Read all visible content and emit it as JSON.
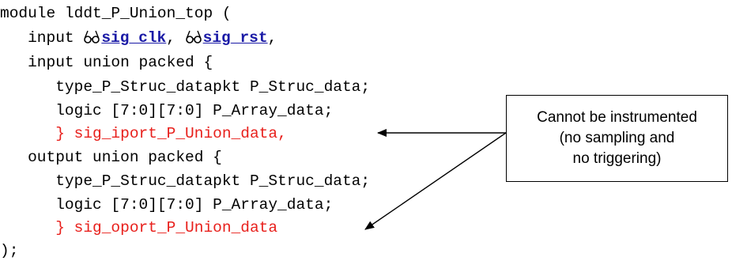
{
  "code": {
    "line1": "module lddt_P_Union_top (",
    "line2_prefix": "   input ",
    "clk_signal": "sig_clk",
    "sep": ", ",
    "rst_signal": "sig_rst",
    "line2_suffix": ",",
    "line3": "   input union packed {",
    "line4": "      type_P_Struc_datapkt P_Struc_data;",
    "line5": "      logic [7:0][7:0] P_Array_data;",
    "line6_indent": "      ",
    "line6_red": "} sig_iport_P_Union_data,",
    "line7": "   output union packed {",
    "line8": "      type_P_Struc_datapkt P_Struc_data;",
    "line9": "      logic [7:0][7:0] P_Array_data;",
    "line10_indent": "      ",
    "line10_red": "} sig_oport_P_Union_data",
    "line11": ");"
  },
  "callout": {
    "line1": "Cannot be instrumented",
    "line2": "(no sampling and",
    "line3": "no triggering)"
  },
  "colors": {
    "red_text": "#e8201c",
    "link_text": "#1a1aa6",
    "text": "#000000"
  },
  "icons": [
    "glasses-icon",
    "glasses-icon"
  ]
}
